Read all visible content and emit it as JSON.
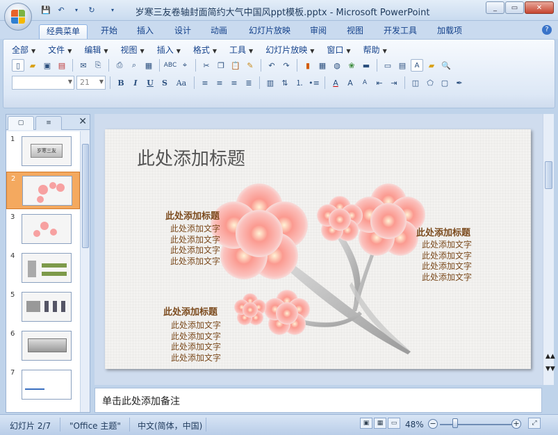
{
  "window": {
    "title": "岁寒三友卷轴封面简约大气中国风ppt模板.pptx - Microsoft PowerPoint"
  },
  "tabs": [
    "经典菜单",
    "开始",
    "插入",
    "设计",
    "动画",
    "幻灯片放映",
    "审阅",
    "视图",
    "开发工具",
    "加载项"
  ],
  "active_tab": "经典菜单",
  "menu": [
    "全部",
    "文件",
    "编辑",
    "视图",
    "插入",
    "格式",
    "工具",
    "幻灯片放映",
    "窗口",
    "帮助"
  ],
  "font_size_value": "21",
  "format_buttons": [
    "B",
    "I",
    "U",
    "S",
    "Aa"
  ],
  "left_panel": {
    "thumbnails": [
      {
        "num": "1",
        "label": "岁寒三友"
      },
      {
        "num": "2",
        "label": ""
      },
      {
        "num": "3",
        "label": ""
      },
      {
        "num": "4",
        "label": ""
      },
      {
        "num": "5",
        "label": ""
      },
      {
        "num": "6",
        "label": ""
      },
      {
        "num": "7",
        "label": ""
      }
    ],
    "selected_index": 2
  },
  "slide": {
    "title": "此处添加标题",
    "sections": [
      {
        "heading": "此处添加标题",
        "lines": [
          "此处添加文字",
          "此处添加文字",
          "此处添加文字",
          "此处添加文字"
        ]
      },
      {
        "heading": "此处添加标题",
        "lines": [
          "此处添加文字",
          "此处添加文字",
          "此处添加文字",
          "此处添加文字"
        ]
      },
      {
        "heading": "此处添加标题",
        "lines": [
          "此处添加文字",
          "此处添加文字",
          "此处添加文字",
          "此处添加文字"
        ]
      }
    ]
  },
  "notes": {
    "placeholder": "单击此处添加备注"
  },
  "status": {
    "slide_indicator": "幻灯片 2/7",
    "theme": "\"Office 主题\"",
    "language": "中文(简体，中国)",
    "zoom": "48%"
  },
  "colors": {
    "accent_text": "#7b4a1d",
    "selected_thumb": "#f4a95f",
    "flower": "#f78d8d"
  }
}
